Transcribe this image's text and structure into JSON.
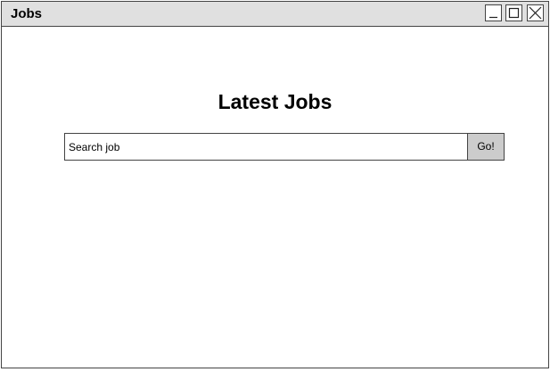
{
  "window": {
    "title": "Jobs",
    "controls": {
      "minimize_icon": "minimize-icon",
      "maximize_icon": "maximize-icon",
      "close_icon": "close-icon"
    }
  },
  "main": {
    "heading": "Latest Jobs",
    "search": {
      "placeholder": "Search job",
      "value": ""
    },
    "go_label": "Go!"
  },
  "colors": {
    "titlebar": "#e0e0e0",
    "border": "#444444",
    "go_button": "#cccccc",
    "background": "#ffffff"
  }
}
